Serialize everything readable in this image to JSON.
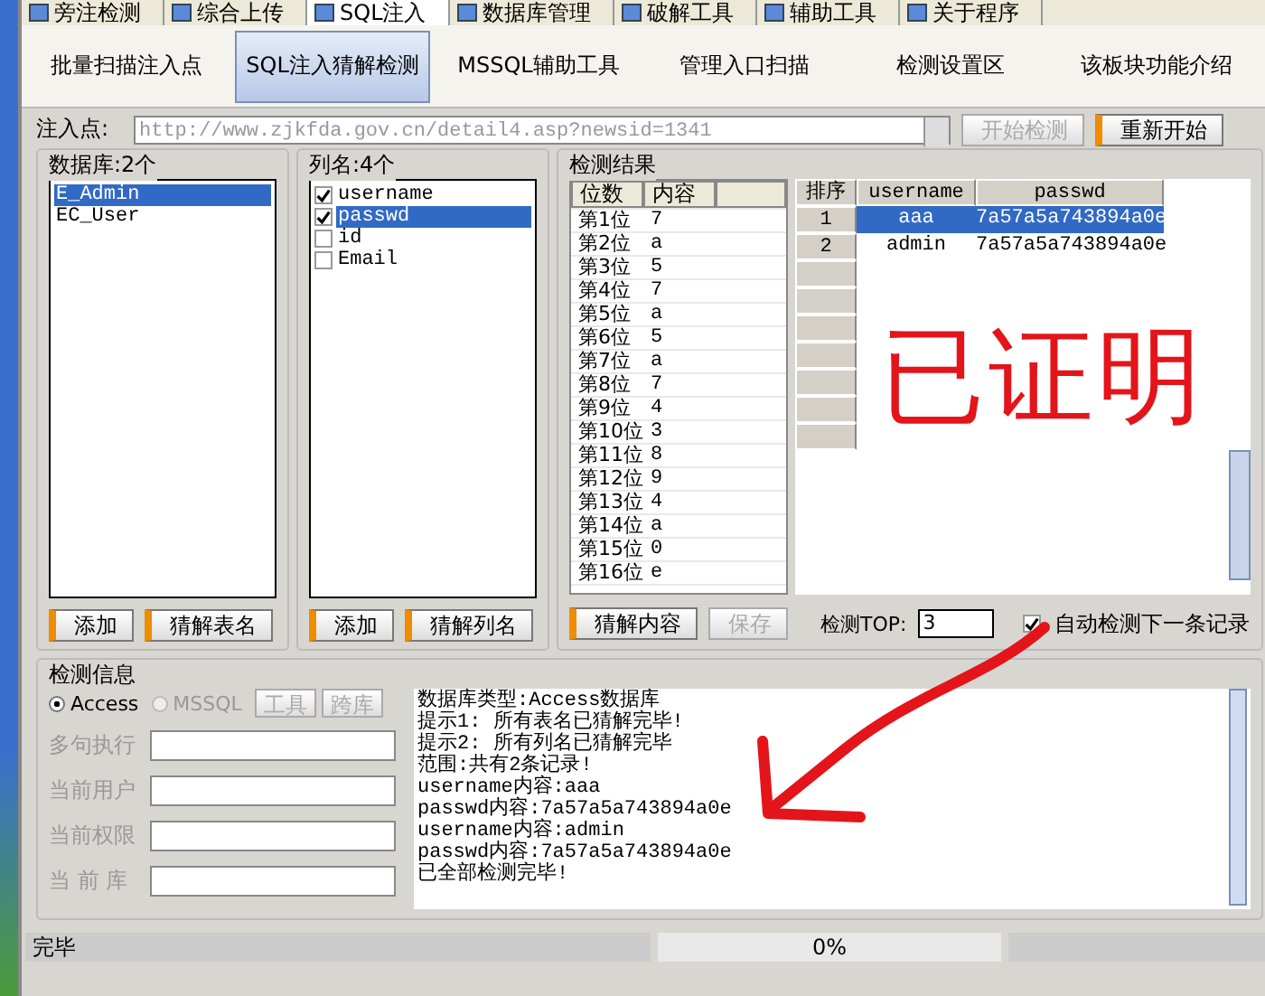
{
  "top_tabs": [
    {
      "label": "旁注检测",
      "selected": false
    },
    {
      "label": "综合上传",
      "selected": false
    },
    {
      "label": "SQL注入",
      "selected": true
    },
    {
      "label": "数据库管理",
      "selected": false
    },
    {
      "label": "破解工具",
      "selected": false
    },
    {
      "label": "辅助工具",
      "selected": false
    },
    {
      "label": "关于程序",
      "selected": false
    }
  ],
  "toolbar": [
    {
      "label": "批量扫描注入点",
      "selected": false
    },
    {
      "label": "SQL注入猜解检测",
      "selected": true
    },
    {
      "label": "MSSQL辅助工具",
      "selected": false
    },
    {
      "label": "管理入口扫描",
      "selected": false
    },
    {
      "label": "检测设置区",
      "selected": false
    },
    {
      "label": "该板块功能介绍",
      "selected": false
    }
  ],
  "injection": {
    "label": "注入点:",
    "url": "http://www.zjkfda.gov.cn/detail4.asp?newsid=1341",
    "buttons": [
      {
        "label": "开始检测",
        "disabled": true
      },
      {
        "label": "重新开始",
        "disabled": false
      }
    ]
  },
  "databases": {
    "title": "数据库:2个",
    "items": [
      {
        "label": "E_Admin",
        "selected": true
      },
      {
        "label": "EC_User",
        "selected": false
      }
    ],
    "buttons": [
      {
        "label": "添加",
        "disabled": false
      },
      {
        "label": "猜解表名",
        "disabled": false
      }
    ]
  },
  "columns": {
    "title": "列名:4个",
    "items": [
      {
        "label": "username",
        "checked": true,
        "selected": false
      },
      {
        "label": "passwd",
        "checked": true,
        "selected": true
      },
      {
        "label": "id",
        "checked": false,
        "selected": false
      },
      {
        "label": "Email",
        "checked": false,
        "selected": false
      }
    ],
    "buttons": [
      {
        "label": "添加",
        "disabled": false
      },
      {
        "label": "猜解列名",
        "disabled": false
      }
    ]
  },
  "results": {
    "title": "检测结果",
    "position_table": {
      "columns": [
        "位数",
        "内容"
      ],
      "rows": [
        [
          "第1位",
          "7"
        ],
        [
          "第2位",
          "a"
        ],
        [
          "第3位",
          "5"
        ],
        [
          "第4位",
          "7"
        ],
        [
          "第5位",
          "a"
        ],
        [
          "第6位",
          "5"
        ],
        [
          "第7位",
          "a"
        ],
        [
          "第8位",
          "7"
        ],
        [
          "第9位",
          "4"
        ],
        [
          "第10位",
          "3"
        ],
        [
          "第11位",
          "8"
        ],
        [
          "第12位",
          "9"
        ],
        [
          "第13位",
          "4"
        ],
        [
          "第14位",
          "a"
        ],
        [
          "第15位",
          "0"
        ],
        [
          "第16位",
          "e"
        ]
      ]
    },
    "record_table": {
      "columns": [
        "排序",
        "username",
        "passwd"
      ],
      "rows": [
        {
          "cells": [
            "1",
            "aaa",
            "7a57a5a743894a0e"
          ],
          "selected": true
        },
        {
          "cells": [
            "2",
            "admin",
            "7a57a5a743894a0e"
          ],
          "selected": false
        }
      ]
    },
    "buttons": [
      {
        "label": "猜解内容",
        "disabled": false
      },
      {
        "label": "保存",
        "disabled": true
      }
    ],
    "top_label": "检测TOP:",
    "top_value": "3",
    "auto_next": {
      "label": "自动检测下一条记录",
      "checked": true
    }
  },
  "info": {
    "title": "检测信息",
    "db_types": [
      {
        "label": "Access",
        "selected": true,
        "disabled": false
      },
      {
        "label": "MSSQL",
        "selected": false,
        "disabled": true
      }
    ],
    "buttons": [
      {
        "label": "工具",
        "disabled": true
      },
      {
        "label": "跨库",
        "disabled": true
      }
    ],
    "fields": [
      {
        "label": "多句执行",
        "disabled": true
      },
      {
        "label": "当前用户",
        "disabled": true
      },
      {
        "label": "当前权限",
        "disabled": true
      },
      {
        "label": "当 前 库",
        "disabled": true
      }
    ],
    "log": [
      "数据库类型:Access数据库",
      "提示1: 所有表名已猜解完毕!",
      "提示2: 所有列名已猜解完毕",
      "范围:共有2条记录!",
      "username内容:aaa",
      "passwd内容:7a57a5a743894a0e",
      "username内容:admin",
      "passwd内容:7a57a5a743894a0e",
      "已全部检测完毕!"
    ]
  },
  "status_bar": {
    "message": "完毕",
    "progress": "0%"
  },
  "annotation": {
    "text": "已证明"
  }
}
